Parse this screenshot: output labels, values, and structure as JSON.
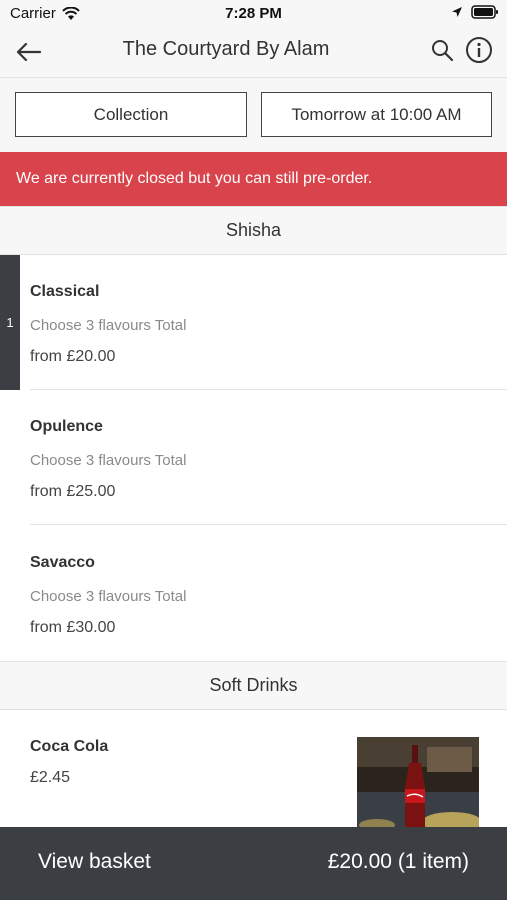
{
  "status_bar": {
    "carrier": "Carrier",
    "time": "7:28 PM"
  },
  "header": {
    "title": "The Courtyard By Alam"
  },
  "options": {
    "collection_label": "Collection",
    "time_label": "Tomorrow at 10:00 AM"
  },
  "banner": {
    "text": "We are currently closed but you can still pre-order."
  },
  "sections": [
    {
      "title": "Shisha",
      "items": [
        {
          "name": "Classical",
          "description": "Choose 3 flavours Total",
          "price": "from £20.00",
          "quantity": "1"
        },
        {
          "name": "Opulence",
          "description": "Choose 3 flavours Total",
          "price": "from £25.00"
        },
        {
          "name": "Savacco",
          "description": "Choose 3 flavours Total",
          "price": "from £30.00"
        }
      ]
    },
    {
      "title": "Soft Drinks",
      "items": [
        {
          "name": "Coca Cola",
          "price": "£2.45"
        }
      ]
    }
  ],
  "basket": {
    "label": "View basket",
    "total": "£20.00 (1 item)"
  },
  "colors": {
    "banner": "#d9434b",
    "dark_bar": "#3b3e43",
    "header_bg": "#f7f7f7"
  }
}
